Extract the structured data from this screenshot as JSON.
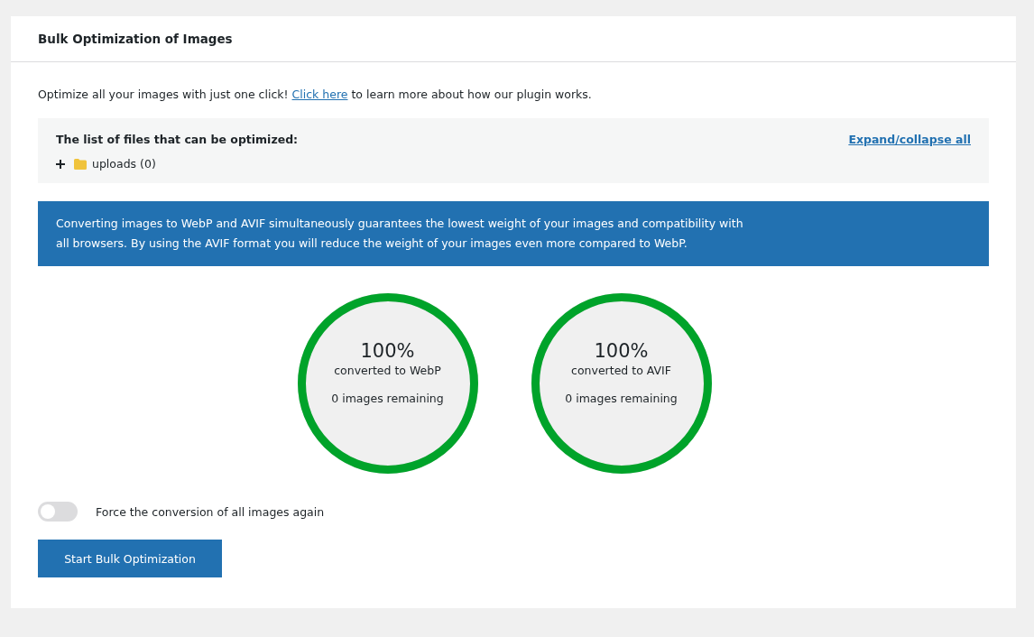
{
  "panel": {
    "title": "Bulk Optimization of Images"
  },
  "intro": {
    "before": "Optimize all your images with just one click! ",
    "link": "Click here",
    "after": " to learn more about how our plugin works."
  },
  "files": {
    "heading": "The list of files that can be optimized:",
    "toggle_all": "Expand/collapse all",
    "tree": [
      {
        "label": "uploads (0)",
        "expanded": false
      }
    ]
  },
  "notice": "Converting images to WebP and AVIF simultaneously guarantees the lowest weight of your images and compatibility with all browsers. By using the AVIF format you will reduce the weight of your images even more compared to WebP.",
  "progress": [
    {
      "percent": "100%",
      "caption": "converted to WebP",
      "remaining": "0 images remaining",
      "level": 1
    },
    {
      "percent": "100%",
      "caption": "converted to AVIF",
      "remaining": "0 images remaining",
      "level": 1
    }
  ],
  "force_option": {
    "label": "Force the conversion of all images again",
    "on": false
  },
  "start_button": "Start Bulk Optimization"
}
